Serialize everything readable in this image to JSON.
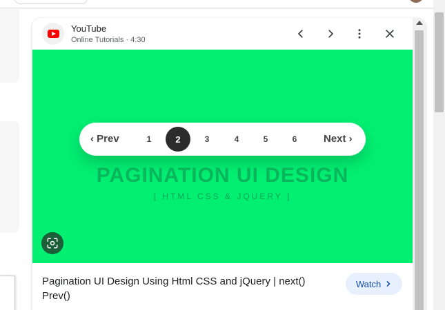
{
  "panel": {
    "source": {
      "name": "YouTube",
      "channel": "Online Tutorials",
      "separator": "·",
      "duration": "4:30",
      "brand_color": "#ff0000"
    },
    "header_icons": [
      "chevron-left-icon",
      "chevron-right-icon",
      "more-vert-icon",
      "close-icon"
    ],
    "preview": {
      "background_color": "#03ef72",
      "pagination": {
        "prev_label": "‹ Prev",
        "pages": [
          "1",
          "2",
          "3",
          "4",
          "5",
          "6"
        ],
        "active_page": "2",
        "next_label": "Next ›"
      },
      "title": "PAGINATION UI DESIGN",
      "subtitle": "[ HTML CSS & JQUERY ]",
      "lens_icon": "google-lens-icon"
    },
    "video_title": "Pagination UI Design Using Html CSS and jQuery | next() Prev()",
    "watch_label": "Watch"
  }
}
